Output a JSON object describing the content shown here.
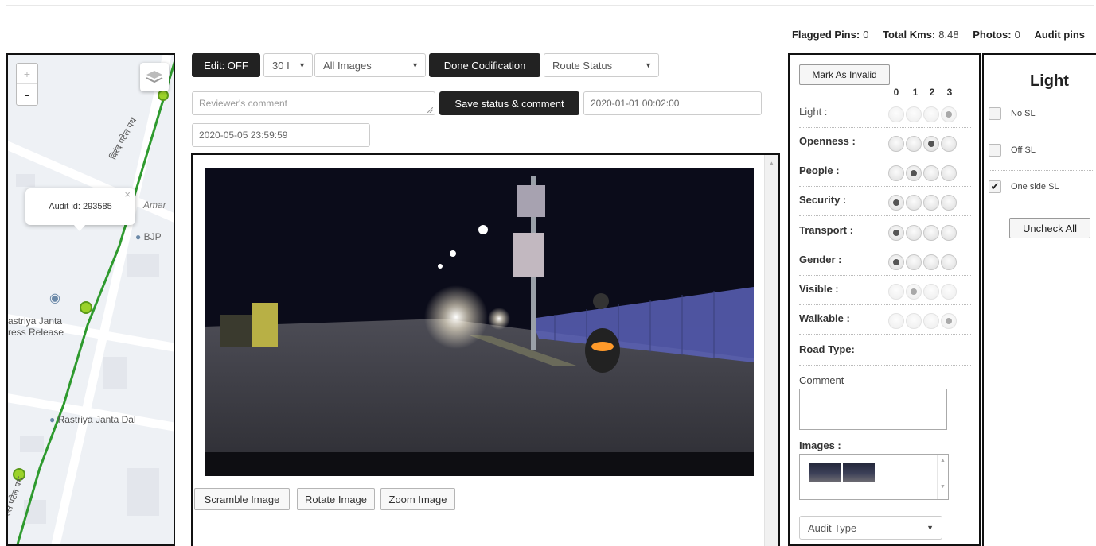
{
  "stats": [
    {
      "label": "Flagged Pins:",
      "value": "0"
    },
    {
      "label": "Total Kms:",
      "value": "8.48"
    },
    {
      "label": "Photos:",
      "value": "0"
    },
    {
      "label": "Audit pins",
      "value": ""
    }
  ],
  "map": {
    "zoom_in": "+",
    "zoom_out": "-",
    "popup_text": "Audit id: 293585",
    "popup_close": "×",
    "poi_amar": "Amar",
    "poi_bjp": "BJP",
    "poi_rjd_line1": "astriya Janta",
    "poi_rjd_line2": "ress Release",
    "poi_rjd2": "Rastriya Janta Dal",
    "road_label": "विरंद पटेल पथ",
    "road_label2": "ल्ल पटेल पथ"
  },
  "toolbar": {
    "edit_label": "Edit: OFF",
    "count_value": "30 I",
    "images_filter": "All Images",
    "done_codification": "Done Codification",
    "route_status": "Route Status",
    "reviewer_placeholder": "Reviewer's comment",
    "save_status": "Save status & comment",
    "date_from": "2020-01-01 00:02:00",
    "date_to": "2020-05-05 23:59:59"
  },
  "viewer": {
    "scramble": "Scramble Image",
    "rotate": "Rotate Image",
    "zoom": "Zoom Image"
  },
  "scoring": {
    "mark_invalid": "Mark As Invalid",
    "columns": [
      "0",
      "1",
      "2",
      "3"
    ],
    "rows": [
      {
        "label": "Light :",
        "selected": 3,
        "style": "light"
      },
      {
        "label": "Openness :",
        "selected": 2,
        "style": "bold"
      },
      {
        "label": "People :",
        "selected": 1,
        "style": "bold"
      },
      {
        "label": "Security :",
        "selected": 0,
        "style": "bold"
      },
      {
        "label": "Transport :",
        "selected": 0,
        "style": "bold"
      },
      {
        "label": "Gender :",
        "selected": 0,
        "style": "bold"
      },
      {
        "label": "Visible :",
        "selected": 1,
        "style": "bold"
      },
      {
        "label": "Walkable :",
        "selected": 3,
        "style": "bold"
      }
    ],
    "road_type": "Road Type:",
    "comment_label": "Comment",
    "images_label": "Images :",
    "audit_type": "Audit Type"
  },
  "light_panel": {
    "title": "Light",
    "options": [
      {
        "label": "No SL",
        "checked": false
      },
      {
        "label": "Off SL",
        "checked": false
      },
      {
        "label": "One side SL",
        "checked": true
      }
    ],
    "uncheck_all": "Uncheck All"
  },
  "colors": {
    "route_line": "#2e9a2e",
    "pin": "#9bd22a",
    "dark_button": "#222222",
    "panel_border": "#111111"
  }
}
